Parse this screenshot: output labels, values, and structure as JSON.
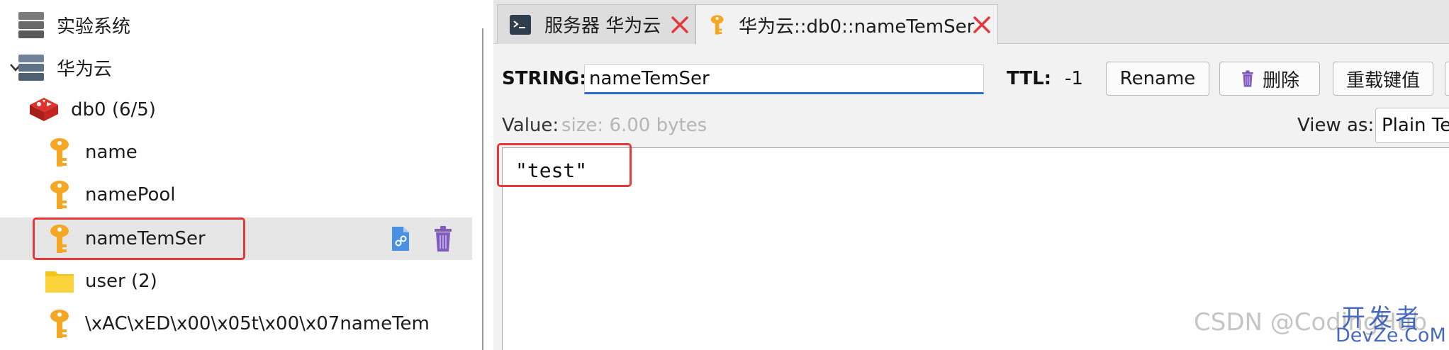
{
  "tree": {
    "items": [
      {
        "label": "实验系统",
        "icon": "server-icon",
        "expanded": false
      },
      {
        "label": "华为云",
        "icon": "server-icon",
        "expanded": true
      },
      {
        "label": "db0  (6/5)",
        "icon": "redis-db-icon"
      },
      {
        "label": "name",
        "icon": "key-icon"
      },
      {
        "label": "namePool",
        "icon": "key-icon"
      },
      {
        "label": "nameTemSer",
        "icon": "key-icon",
        "selected": true
      },
      {
        "label": "user (2)",
        "icon": "folder-icon"
      },
      {
        "label": "\\xAC\\xED\\x00\\x05t\\x00\\x07nameTem",
        "icon": "key-icon"
      }
    ]
  },
  "tabs": [
    {
      "label": "服务器 华为云",
      "icon": "console-icon",
      "active": false
    },
    {
      "label": "华为云::db0::nameTemSer",
      "icon": "key-icon",
      "active": true
    }
  ],
  "toolbar": {
    "type_label": "STRING:",
    "key_name": "nameTemSer",
    "ttl_label": "TTL:",
    "ttl_value": "-1",
    "rename_label": "Rename",
    "delete_label": "删除",
    "reload_label": "重载键值"
  },
  "value": {
    "label": "Value:",
    "size_hint": "size: 6.00 bytes",
    "view_as_label": "View as:",
    "view_as_selected": "Plain Text",
    "content": "\"test\""
  },
  "watermark": {
    "csdn": "CSDN @CodingHub",
    "site_cn": "开发者",
    "site_en": "DevZe.CoM"
  },
  "colors": {
    "highlight_red": "#e4393c",
    "key_orange": "#f5a623",
    "input_focus_blue": "#2a6fd0",
    "trash_purple": "#7e5bbd"
  }
}
